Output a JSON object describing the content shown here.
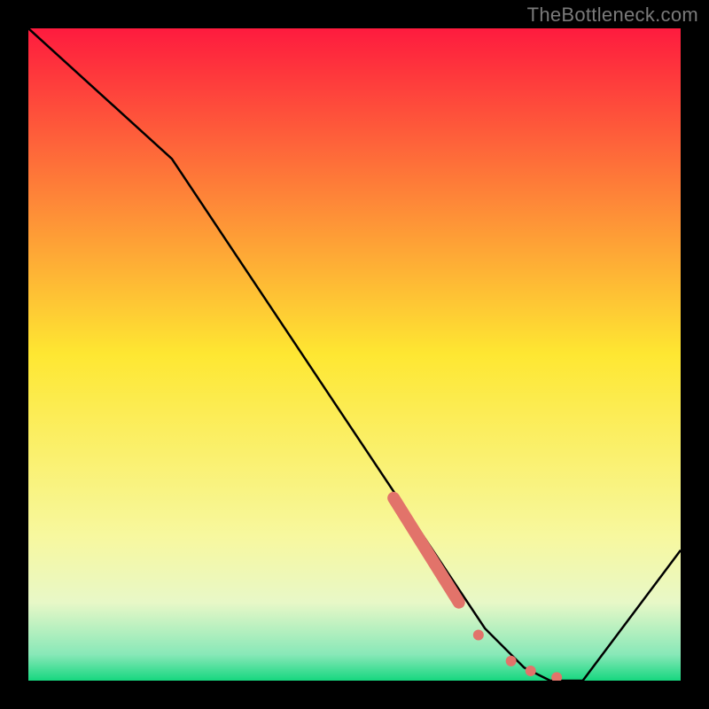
{
  "watermark": "TheBottleneck.com",
  "chart_data": {
    "type": "line",
    "title": "",
    "xlabel": "",
    "ylabel": "",
    "xlim": [
      0,
      100
    ],
    "ylim": [
      0,
      100
    ],
    "grid": false,
    "series": [
      {
        "name": "curve",
        "x": [
          0,
          22,
          62,
          70,
          76,
          80,
          85,
          100
        ],
        "values": [
          100,
          80,
          20,
          8,
          2,
          0,
          0,
          20
        ],
        "color": "#000000"
      }
    ],
    "highlight_segment": {
      "name": "highlight-bold",
      "x": [
        56,
        66
      ],
      "values": [
        28,
        12
      ],
      "color": "#e2736a"
    },
    "highlight_dots": {
      "name": "highlight-dots",
      "points": [
        {
          "x": 69,
          "y": 7
        },
        {
          "x": 74,
          "y": 3
        },
        {
          "x": 77,
          "y": 1.5
        },
        {
          "x": 81,
          "y": 0.5
        }
      ],
      "color": "#e2736a"
    },
    "background_gradient": {
      "stops": [
        {
          "offset": 0.0,
          "color": "#fe1b3e"
        },
        {
          "offset": 0.5,
          "color": "#fee732"
        },
        {
          "offset": 0.78,
          "color": "#f7f89f"
        },
        {
          "offset": 0.88,
          "color": "#e8f8c7"
        },
        {
          "offset": 0.96,
          "color": "#88e8b8"
        },
        {
          "offset": 1.0,
          "color": "#16d77f"
        }
      ]
    }
  }
}
